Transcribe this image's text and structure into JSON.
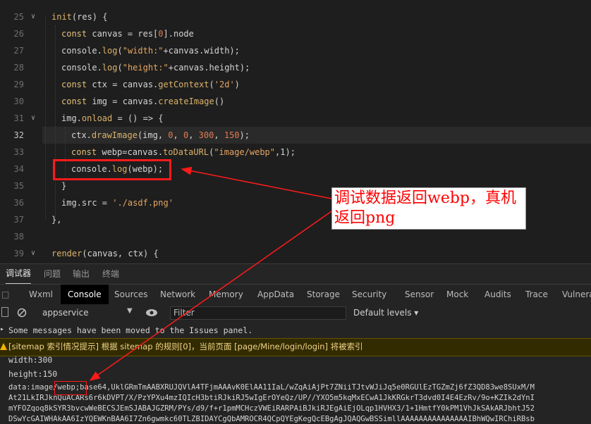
{
  "editor": {
    "line_numbers": [
      "25",
      "26",
      "27",
      "28",
      "29",
      "30",
      "31",
      "32",
      "33",
      "34",
      "35",
      "36",
      "37",
      "38",
      "39"
    ],
    "current_line": "32",
    "lines": {
      "l25": [
        "init",
        "(res) {"
      ],
      "l26": [
        "const",
        " canvas = res[",
        "0",
        "].node"
      ],
      "l27": [
        "console.",
        "log",
        "(",
        "\"width:\"",
        "+canvas.width);"
      ],
      "l28": [
        "console.",
        "log",
        "(",
        "\"height:\"",
        "+canvas.height);"
      ],
      "l29": [
        "const",
        " ctx = canvas.",
        "getContext",
        "(",
        "'2d'",
        ")"
      ],
      "l30": [
        "const",
        " img = canvas.",
        "createImage",
        "()"
      ],
      "l31": [
        "img.",
        "onload",
        " = () => {"
      ],
      "l32": [
        "ctx.",
        "drawImage",
        "(img, ",
        "0",
        ", ",
        "0",
        ", ",
        "300",
        ", ",
        "150",
        ");"
      ],
      "l33": [
        "const",
        " webp=canvas.",
        "toDataURL",
        "(",
        "\"image/webp\"",
        ",1);"
      ],
      "l34": [
        "console.",
        "log",
        "(webp);"
      ],
      "l35": [
        "}"
      ],
      "l36": [
        "img.src = ",
        "'./asdf.png'"
      ],
      "l37": [
        "},"
      ],
      "l39": [
        "render",
        "(canvas, ctx) {"
      ]
    }
  },
  "annotation": {
    "text": "调试数据返回webp，真机返回png"
  },
  "panel_tabs": [
    "调试器",
    "问题",
    "输出",
    "终端"
  ],
  "devtools_tabs": [
    "Wxml",
    "Console",
    "Sources",
    "Network",
    "Memory",
    "AppData",
    "Storage",
    "Security",
    "Sensor",
    "Mock",
    "Audits",
    "Trace",
    "Vulnera"
  ],
  "filter": {
    "context": "appservice",
    "placeholder": "Filter",
    "levels": "Default levels ▾"
  },
  "console": {
    "line1": "Some messages have been moved to the Issues panel.",
    "warning": "[sitemap 索引情况提示] 根据 sitemap 的规则[0]，当前页面 [page/Mine/login/login] 将被索引",
    "width": "width:300",
    "height": "height:150",
    "data1": "data:image/webp;base64,UklGRmTmAABXRUJQVlA4TFjmAAAvK0ElAA11IaL/wZqAiAjPt7ZNiiTJtvWJiJq5e0RGUlEzTGZmZj6fZ3QD83we8SUxM/M",
    "data2": "At21LkIRJknQuACARs6r6kDVPT/X/PzYPXu4mzIQIcH3btiRJkiRJ5wIgErOYeQz/UP//YXO5m5kqMxECwA1JkKRGkrT3dvd0I4E4EzRv/9o+KZIk2dYnI",
    "data3": "mYFOZqoq8kSYR3bvcwWeBECSJEmSJABAJGZRM/PYs/d9/f+r1pmMCHczVWEiRARPAiBJkiRJEgAiEjOLqp1HVHX3/1+1HmtfY0kPM1VhJkSAkARJbhtJ52",
    "data4": "DSwYcGAIWHAkAA6IzYQEWKnBAA6I7Zn6gwmkc60TLZBIDAYCgQbAMROCR4QCpQYEgKegQcEBgAgJQAQGwBSSimllAAAAAAAAAAAAAAAIBhWQwIRChiRBsb"
  },
  "colors": {
    "annotation_red": "#ff0000",
    "highlight_box": "#ff1a1a"
  }
}
